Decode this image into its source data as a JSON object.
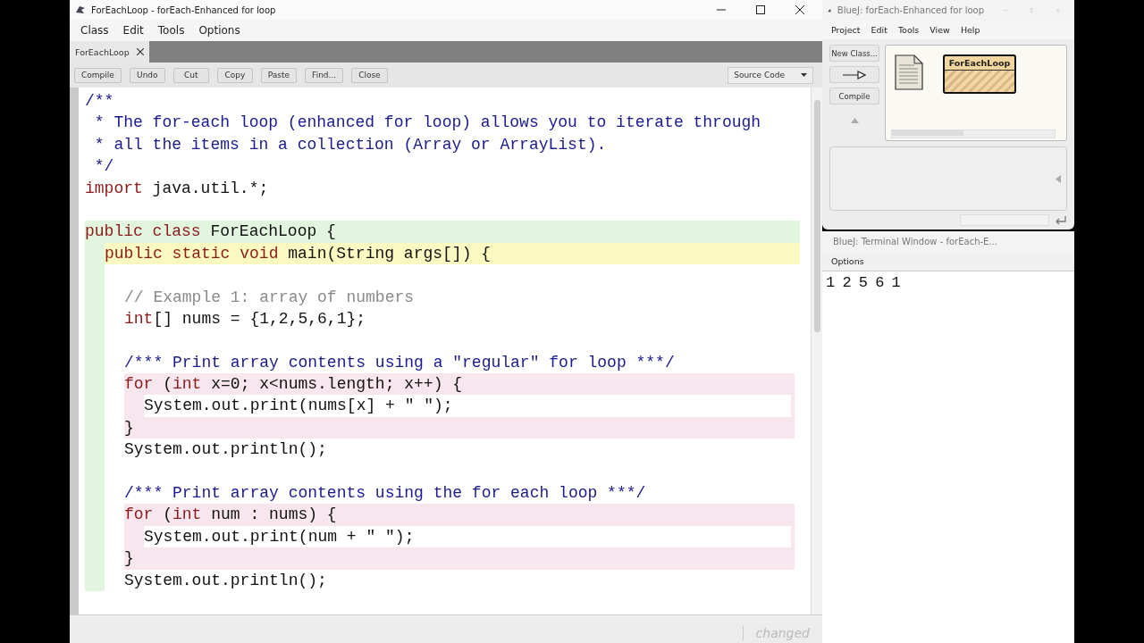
{
  "editor_window": {
    "title": "ForEachLoop - forEach-Enhanced for loop",
    "menu": [
      "Class",
      "Edit",
      "Tools",
      "Options"
    ],
    "tabs": [
      {
        "label": "ForEachLoop",
        "selected": true
      }
    ],
    "toolbar": [
      "Compile",
      "Undo",
      "Cut",
      "Copy",
      "Paste",
      "Find...",
      "Close"
    ],
    "view_select": "Source Code",
    "code_lines": [
      {
        "kind": "none",
        "parts": [
          {
            "kind": "doc",
            "t": "/**"
          }
        ]
      },
      {
        "kind": "none",
        "parts": [
          {
            "kind": "doc",
            "t": " * The for-each loop (enhanced for loop) allows you to iterate through"
          }
        ]
      },
      {
        "kind": "none",
        "parts": [
          {
            "kind": "doc",
            "t": " * all the items in a collection (Array or ArrayList)."
          }
        ]
      },
      {
        "kind": "none",
        "parts": [
          {
            "kind": "doc",
            "t": " */"
          }
        ]
      },
      {
        "kind": "none",
        "parts": [
          {
            "kind": "kw",
            "t": "import"
          },
          {
            "kind": "tx",
            "t": " java.util.*;"
          }
        ]
      },
      {
        "kind": "none"
      },
      {
        "kind": "class",
        "parts": [
          {
            "kind": "kw",
            "t": "public class"
          },
          {
            "kind": "tx",
            "t": " ForEachLoop {"
          }
        ]
      },
      {
        "kind": "method",
        "parts": [
          {
            "kind": "kw",
            "t": "public static void"
          },
          {
            "kind": "tx",
            "t": " main(String args[]) {"
          }
        ]
      },
      {
        "kind": "body"
      },
      {
        "kind": "body",
        "parts": [
          {
            "kind": "cm",
            "t": "// Example 1: array of numbers"
          }
        ]
      },
      {
        "kind": "body",
        "parts": [
          {
            "kind": "kw",
            "t": "int"
          },
          {
            "kind": "tx",
            "t": "[] nums = {1,2,5,6,1};"
          }
        ]
      },
      {
        "kind": "body"
      },
      {
        "kind": "body",
        "parts": [
          {
            "kind": "doc",
            "t": "/*** Print array contents using a \"regular\" for loop ***/"
          }
        ]
      },
      {
        "kind": "loop",
        "parts": [
          {
            "kind": "kw",
            "t": "for"
          },
          {
            "kind": "tx",
            "t": " ("
          },
          {
            "kind": "kw",
            "t": "int"
          },
          {
            "kind": "tx",
            "t": " x=0; x<nums.length; x++) {"
          }
        ]
      },
      {
        "kind": "loop-inner",
        "parts": [
          {
            "kind": "tx",
            "t": "System.out.print(nums[x] + \" \");"
          }
        ]
      },
      {
        "kind": "loop",
        "parts": [
          {
            "kind": "tx",
            "t": "}"
          }
        ]
      },
      {
        "kind": "body",
        "parts": [
          {
            "kind": "tx",
            "t": "System.out.println();"
          }
        ]
      },
      {
        "kind": "body"
      },
      {
        "kind": "body",
        "parts": [
          {
            "kind": "doc",
            "t": "/*** Print array contents using the for each loop ***/"
          }
        ]
      },
      {
        "kind": "loop",
        "parts": [
          {
            "kind": "kw",
            "t": "for"
          },
          {
            "kind": "tx",
            "t": " ("
          },
          {
            "kind": "kw",
            "t": "int"
          },
          {
            "kind": "tx",
            "t": " num : nums) {"
          }
        ]
      },
      {
        "kind": "loop-inner",
        "parts": [
          {
            "kind": "tx",
            "t": "System.out.print(num + \" \");"
          }
        ]
      },
      {
        "kind": "loop",
        "parts": [
          {
            "kind": "tx",
            "t": "}"
          }
        ]
      },
      {
        "kind": "body",
        "parts": [
          {
            "kind": "tx",
            "t": "System.out.println();"
          }
        ]
      }
    ],
    "status": "changed"
  },
  "project_window": {
    "title": "BlueJ:  forEach-Enhanced for loop",
    "menu": [
      "Project",
      "Edit",
      "Tools",
      "View",
      "Help"
    ],
    "new_class_button": "New Class...",
    "compile_button": "Compile",
    "classes": [
      {
        "name": "ForEachLoop",
        "compiled": false
      }
    ]
  },
  "terminal_window": {
    "title": "BlueJ: Terminal Window - forEach-E...",
    "menu": [
      "Options"
    ],
    "output": "1 2 5 6 1"
  }
}
